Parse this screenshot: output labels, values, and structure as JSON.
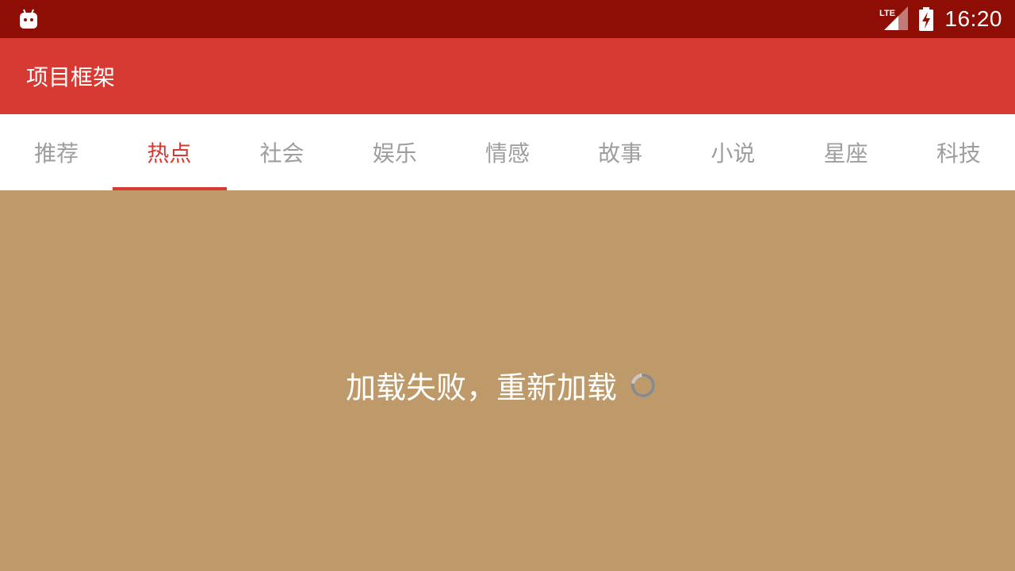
{
  "status_bar": {
    "left_icon": "android-icon",
    "network_label": "LTE",
    "signal_icon": "signal-icon",
    "battery_icon": "battery-charging-icon",
    "time": "16:20"
  },
  "app_bar": {
    "title": "项目框架"
  },
  "tabs": [
    {
      "label": "推荐",
      "active": false
    },
    {
      "label": "热点",
      "active": true
    },
    {
      "label": "社会",
      "active": false
    },
    {
      "label": "娱乐",
      "active": false
    },
    {
      "label": "情感",
      "active": false
    },
    {
      "label": "故事",
      "active": false
    },
    {
      "label": "小说",
      "active": false
    },
    {
      "label": "星座",
      "active": false
    },
    {
      "label": "科技",
      "active": false
    }
  ],
  "content": {
    "message": "加载失败，重新加载",
    "spinner_icon": "loading-spinner-icon"
  },
  "colors": {
    "status_bar": "#8e0d04",
    "app_bar": "#d63a33",
    "active_tab": "#d63a33",
    "inactive_tab": "#9e9e9e",
    "content_bg": "#be9a6a"
  }
}
